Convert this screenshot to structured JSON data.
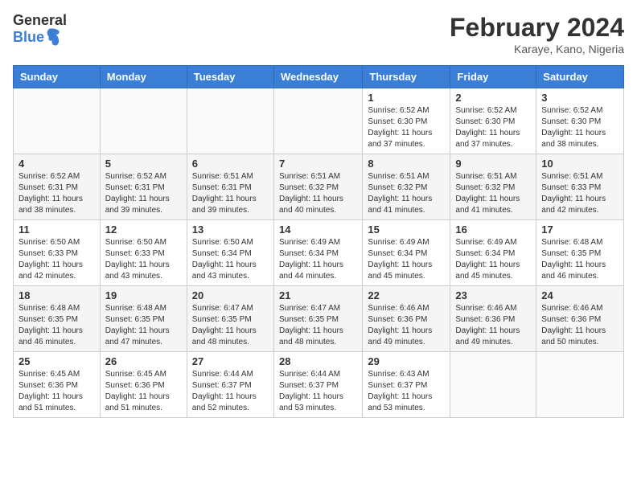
{
  "header": {
    "logo_general": "General",
    "logo_blue": "Blue",
    "month_year": "February 2024",
    "location": "Karaye, Kano, Nigeria"
  },
  "days_of_week": [
    "Sunday",
    "Monday",
    "Tuesday",
    "Wednesday",
    "Thursday",
    "Friday",
    "Saturday"
  ],
  "weeks": [
    [
      {
        "day": "",
        "info": ""
      },
      {
        "day": "",
        "info": ""
      },
      {
        "day": "",
        "info": ""
      },
      {
        "day": "",
        "info": ""
      },
      {
        "day": "1",
        "info": "Sunrise: 6:52 AM\nSunset: 6:30 PM\nDaylight: 11 hours and 37 minutes."
      },
      {
        "day": "2",
        "info": "Sunrise: 6:52 AM\nSunset: 6:30 PM\nDaylight: 11 hours and 37 minutes."
      },
      {
        "day": "3",
        "info": "Sunrise: 6:52 AM\nSunset: 6:30 PM\nDaylight: 11 hours and 38 minutes."
      }
    ],
    [
      {
        "day": "4",
        "info": "Sunrise: 6:52 AM\nSunset: 6:31 PM\nDaylight: 11 hours and 38 minutes."
      },
      {
        "day": "5",
        "info": "Sunrise: 6:52 AM\nSunset: 6:31 PM\nDaylight: 11 hours and 39 minutes."
      },
      {
        "day": "6",
        "info": "Sunrise: 6:51 AM\nSunset: 6:31 PM\nDaylight: 11 hours and 39 minutes."
      },
      {
        "day": "7",
        "info": "Sunrise: 6:51 AM\nSunset: 6:32 PM\nDaylight: 11 hours and 40 minutes."
      },
      {
        "day": "8",
        "info": "Sunrise: 6:51 AM\nSunset: 6:32 PM\nDaylight: 11 hours and 41 minutes."
      },
      {
        "day": "9",
        "info": "Sunrise: 6:51 AM\nSunset: 6:32 PM\nDaylight: 11 hours and 41 minutes."
      },
      {
        "day": "10",
        "info": "Sunrise: 6:51 AM\nSunset: 6:33 PM\nDaylight: 11 hours and 42 minutes."
      }
    ],
    [
      {
        "day": "11",
        "info": "Sunrise: 6:50 AM\nSunset: 6:33 PM\nDaylight: 11 hours and 42 minutes."
      },
      {
        "day": "12",
        "info": "Sunrise: 6:50 AM\nSunset: 6:33 PM\nDaylight: 11 hours and 43 minutes."
      },
      {
        "day": "13",
        "info": "Sunrise: 6:50 AM\nSunset: 6:34 PM\nDaylight: 11 hours and 43 minutes."
      },
      {
        "day": "14",
        "info": "Sunrise: 6:49 AM\nSunset: 6:34 PM\nDaylight: 11 hours and 44 minutes."
      },
      {
        "day": "15",
        "info": "Sunrise: 6:49 AM\nSunset: 6:34 PM\nDaylight: 11 hours and 45 minutes."
      },
      {
        "day": "16",
        "info": "Sunrise: 6:49 AM\nSunset: 6:34 PM\nDaylight: 11 hours and 45 minutes."
      },
      {
        "day": "17",
        "info": "Sunrise: 6:48 AM\nSunset: 6:35 PM\nDaylight: 11 hours and 46 minutes."
      }
    ],
    [
      {
        "day": "18",
        "info": "Sunrise: 6:48 AM\nSunset: 6:35 PM\nDaylight: 11 hours and 46 minutes."
      },
      {
        "day": "19",
        "info": "Sunrise: 6:48 AM\nSunset: 6:35 PM\nDaylight: 11 hours and 47 minutes."
      },
      {
        "day": "20",
        "info": "Sunrise: 6:47 AM\nSunset: 6:35 PM\nDaylight: 11 hours and 48 minutes."
      },
      {
        "day": "21",
        "info": "Sunrise: 6:47 AM\nSunset: 6:35 PM\nDaylight: 11 hours and 48 minutes."
      },
      {
        "day": "22",
        "info": "Sunrise: 6:46 AM\nSunset: 6:36 PM\nDaylight: 11 hours and 49 minutes."
      },
      {
        "day": "23",
        "info": "Sunrise: 6:46 AM\nSunset: 6:36 PM\nDaylight: 11 hours and 49 minutes."
      },
      {
        "day": "24",
        "info": "Sunrise: 6:46 AM\nSunset: 6:36 PM\nDaylight: 11 hours and 50 minutes."
      }
    ],
    [
      {
        "day": "25",
        "info": "Sunrise: 6:45 AM\nSunset: 6:36 PM\nDaylight: 11 hours and 51 minutes."
      },
      {
        "day": "26",
        "info": "Sunrise: 6:45 AM\nSunset: 6:36 PM\nDaylight: 11 hours and 51 minutes."
      },
      {
        "day": "27",
        "info": "Sunrise: 6:44 AM\nSunset: 6:37 PM\nDaylight: 11 hours and 52 minutes."
      },
      {
        "day": "28",
        "info": "Sunrise: 6:44 AM\nSunset: 6:37 PM\nDaylight: 11 hours and 53 minutes."
      },
      {
        "day": "29",
        "info": "Sunrise: 6:43 AM\nSunset: 6:37 PM\nDaylight: 11 hours and 53 minutes."
      },
      {
        "day": "",
        "info": ""
      },
      {
        "day": "",
        "info": ""
      }
    ]
  ]
}
